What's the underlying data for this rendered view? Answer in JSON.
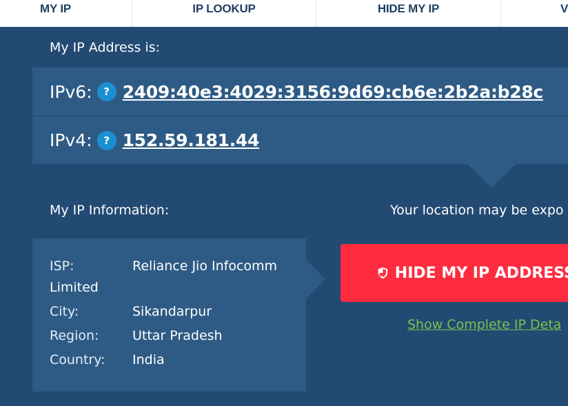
{
  "nav": {
    "items": [
      {
        "label": "MY IP"
      },
      {
        "label": "IP LOOKUP"
      },
      {
        "label": "HIDE MY IP"
      },
      {
        "label": "V"
      }
    ]
  },
  "ip_section": {
    "heading": "My IP Address is:",
    "ipv6": {
      "label": "IPv6:",
      "help": "?",
      "value": "2409:40e3:4029:3156:9d69:cb6e:2b2a:b28c"
    },
    "ipv4": {
      "label": "IPv4:",
      "help": "?",
      "value": "152.59.181.44"
    }
  },
  "info_section": {
    "heading": "My IP Information:",
    "isp": {
      "key": "ISP:",
      "value_line1": "Reliance Jio Infocomm",
      "value_line2": "Limited"
    },
    "city": {
      "key": "City:",
      "value": "Sikandarpur"
    },
    "region": {
      "key": "Region:",
      "value": "Uttar Pradesh"
    },
    "country": {
      "key": "Country:",
      "value": "India"
    }
  },
  "location_warning": "Your location may be expo",
  "hide_button": {
    "label": "HIDE MY IP ADDRESS",
    "icon": "shield-icon"
  },
  "details_link": "Show Complete IP Deta",
  "colors": {
    "background": "#234a73",
    "panel": "#2e5b85",
    "accent_red": "#ff2c40",
    "link_green": "#7cc04a",
    "help_blue": "#1c8fd1"
  }
}
